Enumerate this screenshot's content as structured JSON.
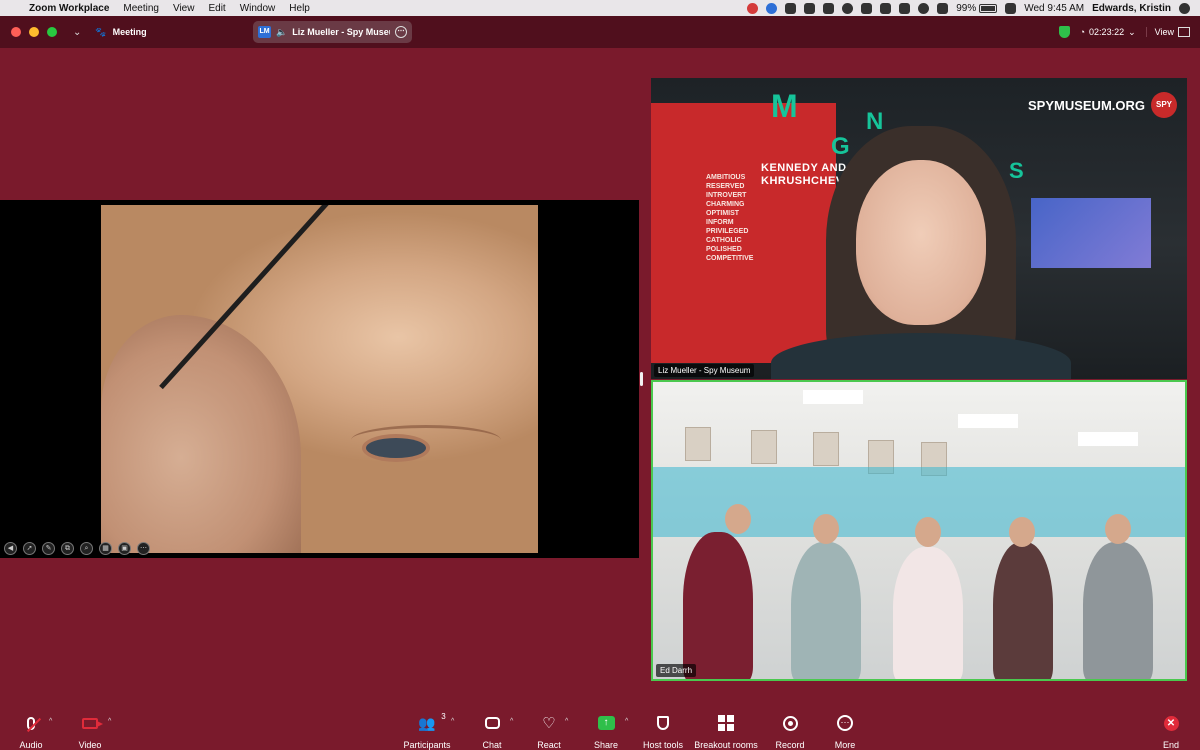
{
  "menubar": {
    "app_name": "Zoom Workplace",
    "menus": [
      "Meeting",
      "View",
      "Edit",
      "Window",
      "Help"
    ],
    "battery_percent": "99%",
    "battery_level": 0.99,
    "datetime": "Wed 9:45 AM",
    "user_name": "Edwards, Kristin"
  },
  "titlebar": {
    "meeting_label": "Meeting",
    "active_speaker_initials": "LM",
    "active_speaker": "Liz Mueller - Spy Museum",
    "timer": "02:23:22",
    "view_label": "View"
  },
  "share": {
    "pen_tools": [
      "◀",
      "➚",
      "✎",
      "⧉",
      "⌕",
      "▦",
      "▣",
      "⋯"
    ]
  },
  "tiles": {
    "top": {
      "name": "Liz Mueller - Spy Museum",
      "logo_text": "SPYMUSEUM.ORG",
      "logo_badge": "SPY",
      "wall_words": [
        "AMBITIOUS",
        "RESERVED",
        "INTROVERT",
        "CHARMING",
        "OPTIMIST",
        "INFORM",
        "PRIVILEGED",
        "CATHOLIC",
        "POLISHED",
        "COMPETITIVE"
      ],
      "exhibit_title": [
        "KENNEDY AND",
        "KHRUSHCHEV"
      ],
      "letters": [
        "M",
        "G",
        "N",
        "S"
      ]
    },
    "bottom": {
      "name": "Ed Darrh"
    }
  },
  "toolbar": {
    "audio": "Audio",
    "video": "Video",
    "participants": "Participants",
    "participants_count": "3",
    "chat": "Chat",
    "react": "React",
    "share": "Share",
    "host_tools": "Host tools",
    "breakout_rooms": "Breakout rooms",
    "record": "Record",
    "more": "More",
    "end": "End"
  },
  "colors": {
    "background": "#7a1a2c",
    "titlebar": "#500f1d",
    "active_speaker_border": "#4bc84f",
    "end_red": "#e02b3a",
    "share_green": "#2fbf4a"
  }
}
